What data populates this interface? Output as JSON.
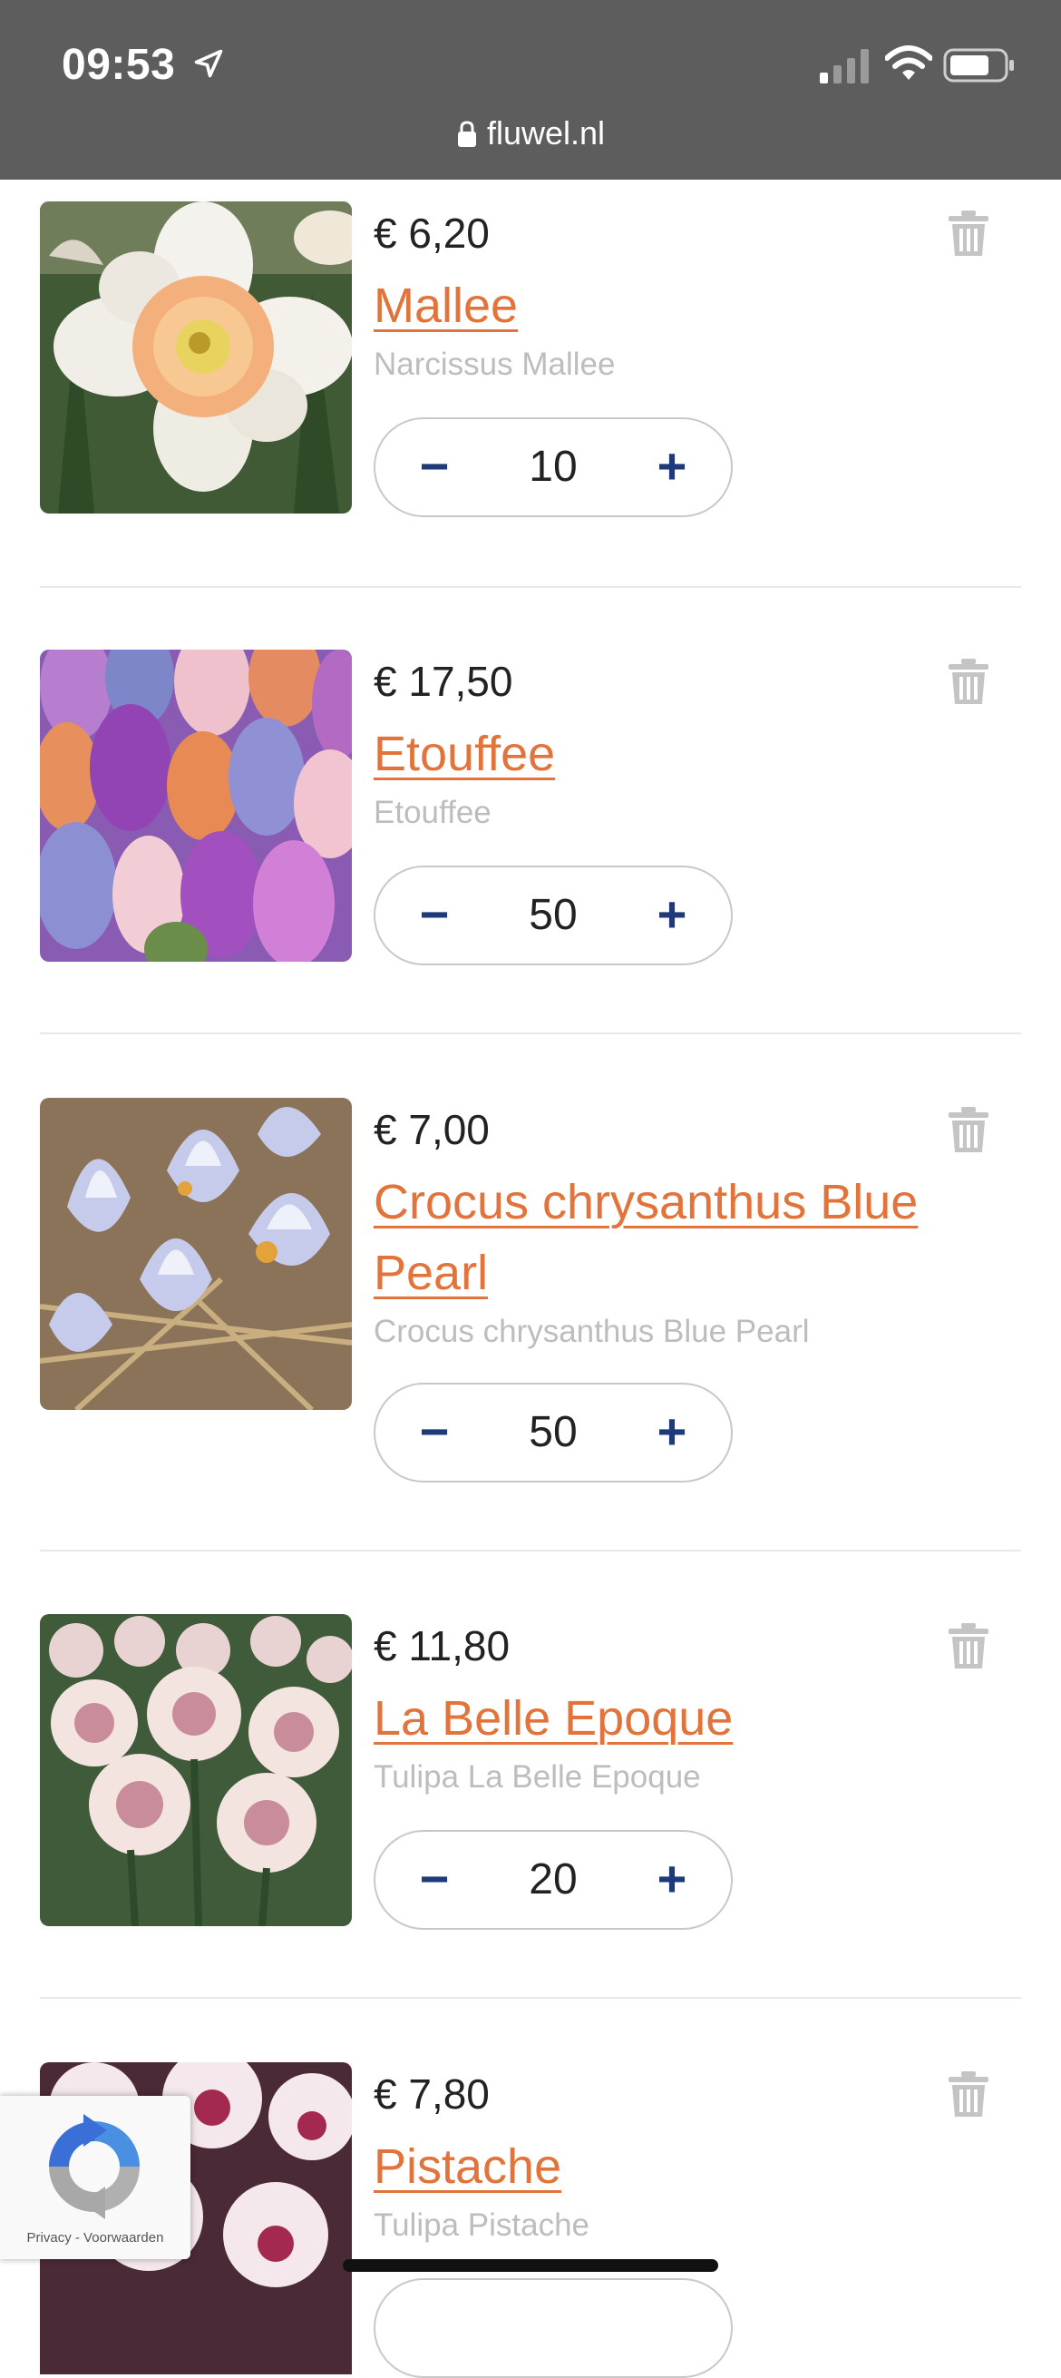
{
  "status_bar": {
    "time": "09:53",
    "url": "fluwel.nl"
  },
  "cart_items": [
    {
      "price": "€ 6,20",
      "name": "Mallee",
      "latin": "Narcissus Mallee",
      "qty": "10"
    },
    {
      "price": "€ 17,50",
      "name": "Etouffee",
      "latin": "Etouffee",
      "qty": "50"
    },
    {
      "price": "€ 7,00",
      "name": "Crocus chrysanthus Blue Pearl",
      "latin": "Crocus chrysanthus Blue Pearl",
      "qty": "50"
    },
    {
      "price": "€ 11,80",
      "name": "La Belle Epoque",
      "latin": "Tulipa La Belle Epoque",
      "qty": "20"
    },
    {
      "price": "€ 7,80",
      "name": "Pistache",
      "latin": "Tulipa Pistache",
      "qty": ""
    }
  ],
  "stepper": {
    "minus": "−",
    "plus": "+"
  },
  "recaptcha": {
    "text": "Privacy - Voorwaarden"
  },
  "colors": {
    "accent": "#e2733a",
    "stepper_icon": "#1f3a7a",
    "status_bar": "#5d5d5d",
    "muted": "#bdbdbd"
  }
}
